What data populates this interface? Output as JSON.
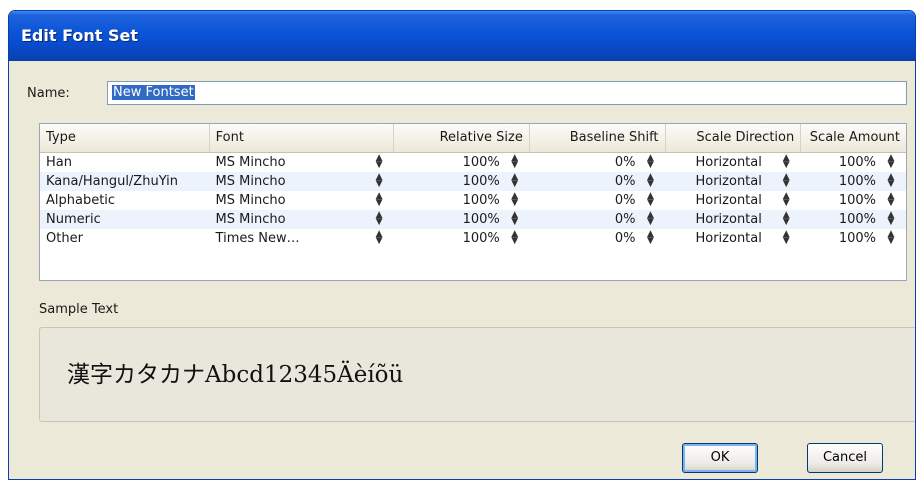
{
  "window": {
    "title": "Edit Font Set"
  },
  "name_field": {
    "label": "Name:",
    "value": "New Fontset"
  },
  "table": {
    "headers": [
      "Type",
      "Font",
      "Relative Size",
      "Baseline Shift",
      "Scale Direction",
      "Scale Amount"
    ],
    "rows": [
      {
        "type": "Han",
        "font": "MS Mincho",
        "relative_size": "100%",
        "baseline_shift": "0%",
        "scale_direction": "Horizontal",
        "scale_amount": "100%"
      },
      {
        "type": "Kana/Hangul/ZhuYin",
        "font": "MS Mincho",
        "relative_size": "100%",
        "baseline_shift": "0%",
        "scale_direction": "Horizontal",
        "scale_amount": "100%"
      },
      {
        "type": "Alphabetic",
        "font": "MS Mincho",
        "relative_size": "100%",
        "baseline_shift": "0%",
        "scale_direction": "Horizontal",
        "scale_amount": "100%"
      },
      {
        "type": "Numeric",
        "font": "MS Mincho",
        "relative_size": "100%",
        "baseline_shift": "0%",
        "scale_direction": "Horizontal",
        "scale_amount": "100%"
      },
      {
        "type": "Other",
        "font": "Times New…",
        "relative_size": "100%",
        "baseline_shift": "0%",
        "scale_direction": "Horizontal",
        "scale_amount": "100%"
      }
    ]
  },
  "sample": {
    "label": "Sample Text",
    "text": "漢字カタカナAbcd12345Äèíõü"
  },
  "buttons": {
    "ok": "OK",
    "cancel": "Cancel"
  },
  "colors": {
    "title_bar": "#0a53d8",
    "dialog_bg": "#ece9d8",
    "selection": "#316ac5"
  }
}
